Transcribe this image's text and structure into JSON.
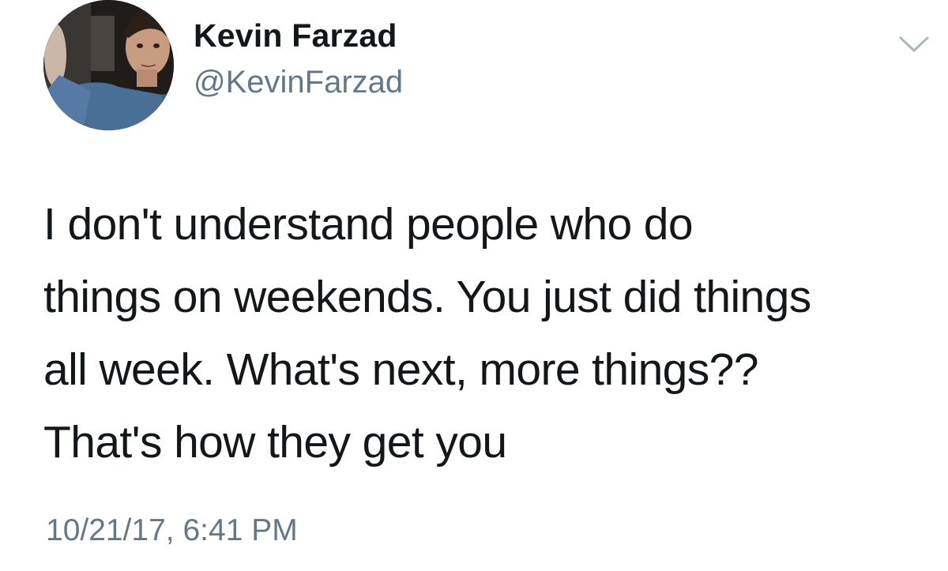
{
  "author": {
    "display_name": "Kevin Farzad",
    "handle": "@KevinFarzad",
    "avatar_icon": "profile-photo"
  },
  "tweet": {
    "lines": [
      "I don't understand people who do",
      "things on weekends. You just did things",
      "all week. What's next, more things??",
      "That's how they get you"
    ],
    "timestamp": "10/21/17, 6:41 PM"
  },
  "menu": {
    "icon": "chevron-down-icon"
  },
  "colors": {
    "text_primary": "#14171a",
    "text_secondary": "#657786",
    "caret": "#aab8c2",
    "background": "#ffffff"
  }
}
